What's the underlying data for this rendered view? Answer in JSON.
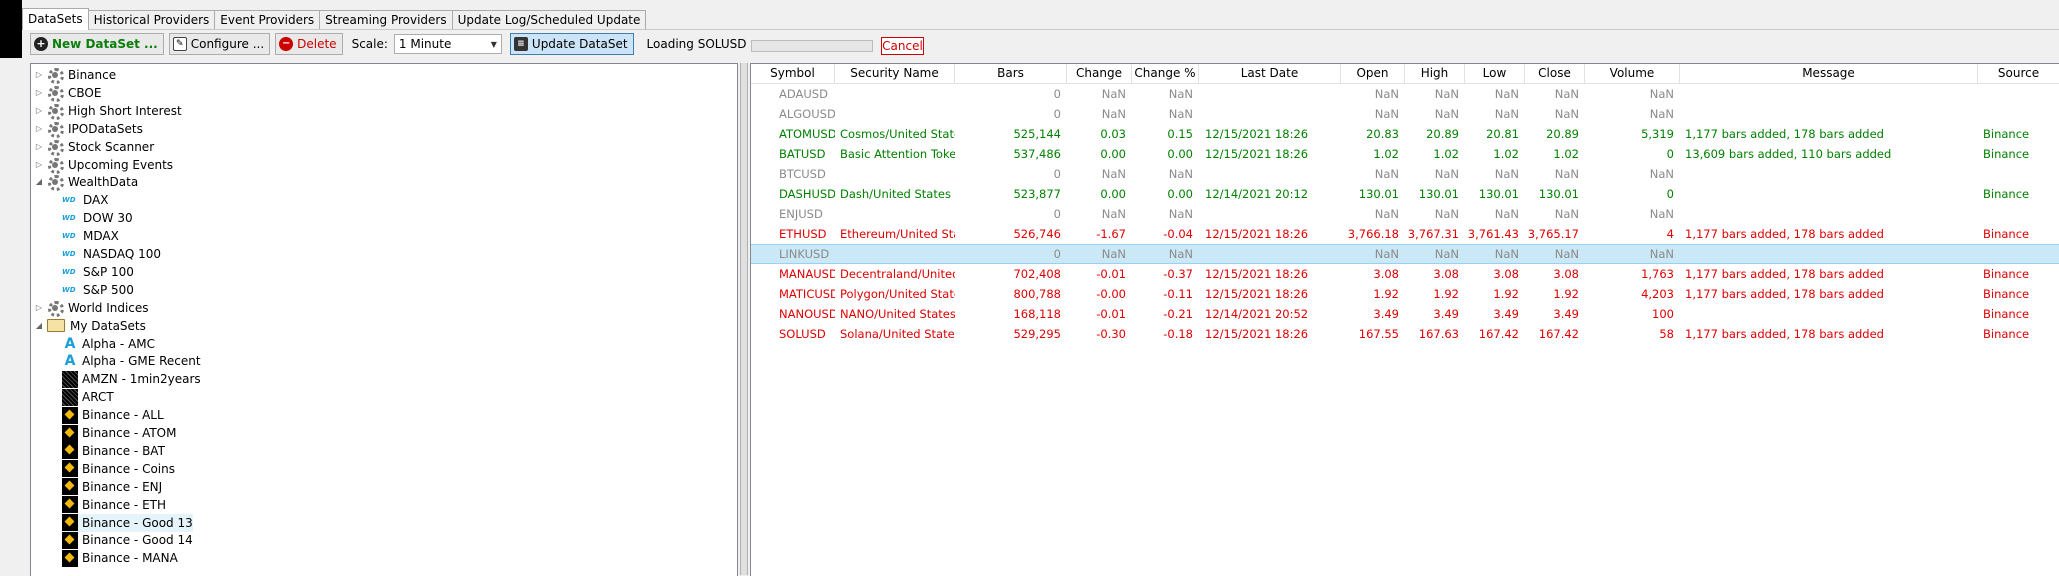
{
  "tabs": [
    "DataSets",
    "Historical Providers",
    "Event Providers",
    "Streaming Providers",
    "Update Log/Scheduled Update"
  ],
  "toolbar": {
    "new_label": "New DataSet ...",
    "configure_label": "Configure ...",
    "delete_label": "Delete",
    "scale_label": "Scale:",
    "scale_value": "1 Minute",
    "update_label": "Update DataSet",
    "loading_text": "Loading SOLUSD ...",
    "cancel_label": "Cancel",
    "progress_fraction": 0.0
  },
  "colors": {
    "gain": "#008000",
    "loss": "#e00000",
    "stale": "#8a8a8a"
  },
  "tree": [
    {
      "label": "Binance",
      "icon": "gear-icon",
      "toggle": "collapsed"
    },
    {
      "label": "CBOE",
      "icon": "gear-icon",
      "toggle": "collapsed"
    },
    {
      "label": "High Short Interest",
      "icon": "gear-icon",
      "toggle": "collapsed"
    },
    {
      "label": "IPODataSets",
      "icon": "gear-icon",
      "toggle": "collapsed"
    },
    {
      "label": "Stock Scanner",
      "icon": "gear-icon",
      "toggle": "collapsed"
    },
    {
      "label": "Upcoming Events",
      "icon": "gear-icon",
      "toggle": "collapsed"
    },
    {
      "label": "WealthData",
      "icon": "gear-icon",
      "toggle": "expanded"
    },
    {
      "label": "DAX",
      "icon": "wd-icon",
      "child": true
    },
    {
      "label": "DOW 30",
      "icon": "wd-icon",
      "child": true
    },
    {
      "label": "MDAX",
      "icon": "wd-icon",
      "child": true
    },
    {
      "label": "NASDAQ 100",
      "icon": "wd-icon",
      "child": true
    },
    {
      "label": "S&P 100",
      "icon": "wd-icon",
      "child": true
    },
    {
      "label": "S&P 500",
      "icon": "wd-icon",
      "child": true
    },
    {
      "label": "World Indices",
      "icon": "gear-icon",
      "toggle": "collapsed"
    },
    {
      "label": "My DataSets",
      "icon": "folder-icon",
      "toggle": "expanded"
    },
    {
      "label": "Alpha - AMC",
      "icon": "alpha-icon",
      "child": true
    },
    {
      "label": "Alpha - GME Recent",
      "icon": "alpha-icon",
      "child": true
    },
    {
      "label": "AMZN - 1min2years",
      "icon": "noise-icon",
      "child": true
    },
    {
      "label": "ARCT",
      "icon": "noise-icon",
      "child": true
    },
    {
      "label": "Binance - ALL",
      "icon": "binance-icon",
      "child": true
    },
    {
      "label": "Binance - ATOM",
      "icon": "binance-icon",
      "child": true
    },
    {
      "label": "Binance - BAT",
      "icon": "binance-icon",
      "child": true
    },
    {
      "label": "Binance - Coins",
      "icon": "binance-icon",
      "child": true
    },
    {
      "label": "Binance - ENJ",
      "icon": "binance-icon",
      "child": true
    },
    {
      "label": "Binance - ETH",
      "icon": "binance-icon",
      "child": true
    },
    {
      "label": "Binance - Good 13",
      "icon": "binance-icon",
      "child": true,
      "selected": true
    },
    {
      "label": "Binance - Good 14",
      "icon": "binance-icon",
      "child": true
    },
    {
      "label": "Binance - MANA",
      "icon": "binance-icon",
      "child": true
    }
  ],
  "columns": [
    "Symbol",
    "Security Name",
    "Bars",
    "Change",
    "Change %",
    "Last Date",
    "Open",
    "High",
    "Low",
    "Close",
    "Volume",
    "Message",
    "Source"
  ],
  "rows": [
    {
      "status": "stale",
      "cells": [
        "ADAUSD",
        "",
        "0",
        "NaN",
        "NaN",
        "",
        "NaN",
        "NaN",
        "NaN",
        "NaN",
        "NaN",
        "",
        ""
      ]
    },
    {
      "status": "stale",
      "cells": [
        "ALGOUSD",
        "",
        "0",
        "NaN",
        "NaN",
        "",
        "NaN",
        "NaN",
        "NaN",
        "NaN",
        "NaN",
        "",
        ""
      ]
    },
    {
      "status": "gain",
      "cells": [
        "ATOMUSD",
        "Cosmos/United States",
        "525,144",
        "0.03",
        "0.15",
        "12/15/2021 18:26",
        "20.83",
        "20.89",
        "20.81",
        "20.89",
        "5,319",
        "1,177 bars added, 178 bars added",
        "Binance"
      ]
    },
    {
      "status": "gain",
      "cells": [
        "BATUSD",
        "Basic Attention Token",
        "537,486",
        "0.00",
        "0.00",
        "12/15/2021 18:26",
        "1.02",
        "1.02",
        "1.02",
        "1.02",
        "0",
        "13,609 bars added, 110 bars added",
        "Binance"
      ]
    },
    {
      "status": "stale",
      "cells": [
        "BTCUSD",
        "",
        "0",
        "NaN",
        "NaN",
        "",
        "NaN",
        "NaN",
        "NaN",
        "NaN",
        "NaN",
        "",
        ""
      ]
    },
    {
      "status": "gain",
      "cells": [
        "DASHUSD",
        "Dash/United States Dollar",
        "523,877",
        "0.00",
        "0.00",
        "12/14/2021 20:12",
        "130.01",
        "130.01",
        "130.01",
        "130.01",
        "0",
        "",
        "Binance"
      ]
    },
    {
      "status": "stale",
      "cells": [
        "ENJUSD",
        "",
        "0",
        "NaN",
        "NaN",
        "",
        "NaN",
        "NaN",
        "NaN",
        "NaN",
        "NaN",
        "",
        ""
      ]
    },
    {
      "status": "loss",
      "cells": [
        "ETHUSD",
        "Ethereum/United States",
        "526,746",
        "-1.67",
        "-0.04",
        "12/15/2021 18:26",
        "3,766.18",
        "3,767.31",
        "3,761.43",
        "3,765.17",
        "4",
        "1,177 bars added, 178 bars added",
        "Binance"
      ]
    },
    {
      "status": "stale",
      "selected": true,
      "cells": [
        "LINKUSD",
        "",
        "0",
        "NaN",
        "NaN",
        "",
        "NaN",
        "NaN",
        "NaN",
        "NaN",
        "NaN",
        "",
        ""
      ]
    },
    {
      "status": "loss",
      "cells": [
        "MANAUSD",
        "Decentraland/United States",
        "702,408",
        "-0.01",
        "-0.37",
        "12/15/2021 18:26",
        "3.08",
        "3.08",
        "3.08",
        "3.08",
        "1,763",
        "1,177 bars added, 178 bars added",
        "Binance"
      ]
    },
    {
      "status": "loss",
      "cells": [
        "MATICUSD",
        "Polygon/United States",
        "800,788",
        "-0.00",
        "-0.11",
        "12/15/2021 18:26",
        "1.92",
        "1.92",
        "1.92",
        "1.92",
        "4,203",
        "1,177 bars added, 178 bars added",
        "Binance"
      ]
    },
    {
      "status": "loss",
      "cells": [
        "NANOUSD",
        "NANO/United States",
        "168,118",
        "-0.01",
        "-0.21",
        "12/14/2021 20:52",
        "3.49",
        "3.49",
        "3.49",
        "3.49",
        "100",
        "",
        "Binance"
      ]
    },
    {
      "status": "loss",
      "cells": [
        "SOLUSD",
        "Solana/United States",
        "529,295",
        "-0.30",
        "-0.18",
        "12/15/2021 18:26",
        "167.55",
        "167.63",
        "167.42",
        "167.42",
        "58",
        "1,177 bars added, 178 bars added",
        "Binance"
      ]
    }
  ]
}
